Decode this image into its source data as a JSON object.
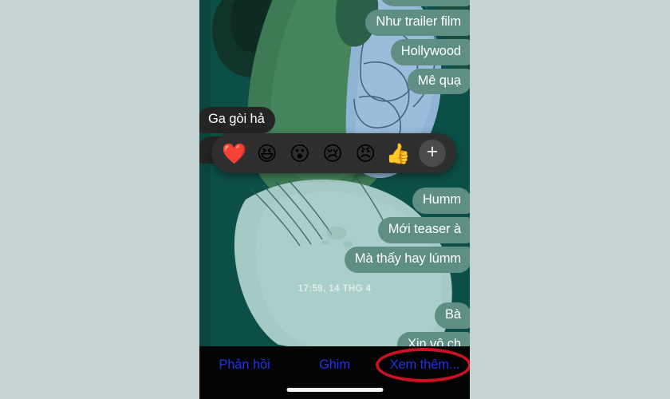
{
  "app": {
    "platform": "ios-messenger",
    "screen_bg_color": "#0c4f46",
    "page_bg_color": "#c5d3d5"
  },
  "wallpaper": {
    "name": "illustrated-hands-artwork",
    "colors": {
      "base_dark_teal": "#0c4f46",
      "mid_green": "#3f7a53",
      "dark_green": "#123b2f",
      "light_blue_hand": "#8fb4d4",
      "pale_teal_palm": "#a8cbc6",
      "outline": "#2d5a4c"
    }
  },
  "conversation": {
    "messages": [
      {
        "id": "m0",
        "text": "",
        "side": "out",
        "clipped": true,
        "visible_text": ""
      },
      {
        "id": "m1",
        "text": "Như trailer film",
        "side": "out"
      },
      {
        "id": "m2",
        "text": "Hollywood",
        "side": "out"
      },
      {
        "id": "m3",
        "text": "Mê quạ",
        "side": "out"
      },
      {
        "id": "m4",
        "text": "Ga gòi hả",
        "side": "in"
      },
      {
        "id": "m5",
        "text": "",
        "side": "in",
        "obscured_by": "reaction-bar"
      },
      {
        "id": "m6",
        "text": "Humm",
        "side": "out"
      },
      {
        "id": "m7",
        "text": "Mới teaser à",
        "side": "out"
      },
      {
        "id": "m8",
        "text": "Mà thấy hay lúmm",
        "side": "out"
      },
      {
        "id": "m9",
        "text": "Bà",
        "side": "out"
      },
      {
        "id": "m10",
        "text": "Xin vô ch",
        "side": "out"
      }
    ],
    "timestamp_divider": "17:59, 14 THG 4",
    "bubble_colors": {
      "outgoing": "#5f8e84",
      "incoming": "#242424",
      "text": "#ffffff"
    }
  },
  "reaction_bar": {
    "name": "message-reaction-picker",
    "background_color": "#2e2e2e",
    "reactions": [
      {
        "name": "heart-reaction",
        "glyph": "❤️"
      },
      {
        "name": "laughing-reaction",
        "glyph": "😆"
      },
      {
        "name": "surprised-reaction",
        "glyph": "😮"
      },
      {
        "name": "crying-reaction",
        "glyph": "😢"
      },
      {
        "name": "angry-reaction",
        "glyph": "😠"
      },
      {
        "name": "thumbs-up-reaction",
        "glyph": "👍"
      }
    ],
    "add_more_label": "+"
  },
  "action_bar": {
    "background_color": "#030303",
    "text_color": "#1c33e8",
    "buttons": [
      {
        "name": "reply-button",
        "label": "Phản hồi"
      },
      {
        "name": "pin-button",
        "label": "Ghim"
      },
      {
        "name": "more-button",
        "label": "Xem thêm...",
        "highlighted": true
      }
    ]
  },
  "annotation": {
    "name": "red-highlight-oval",
    "target": "Xem thêm...",
    "color": "#cc1122",
    "stroke_width": 4
  },
  "home_indicator": {
    "color": "#f4f4f4"
  }
}
